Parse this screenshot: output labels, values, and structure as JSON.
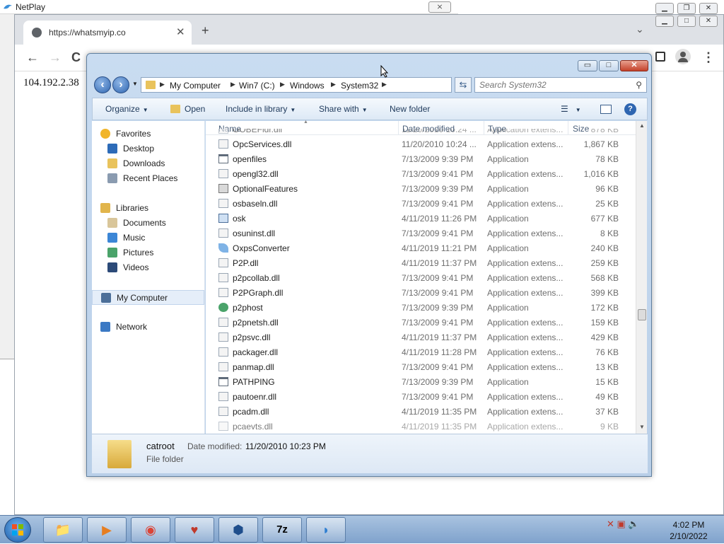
{
  "netplay": {
    "title": "NetPlay",
    "close_label": "⨯"
  },
  "browser": {
    "tab_title": "https://whatsmyip.co",
    "tab_close": "✕",
    "new_tab": "+",
    "tab_dropdown": "⌄",
    "page_text": "104.192.2.38",
    "back": "←",
    "forward": "→",
    "reload": "C",
    "menu": "⋮"
  },
  "explorer": {
    "title_controls": {
      "minimize": "▭",
      "maximize": "□",
      "close": "✕"
    },
    "breadcrumb": [
      "My Computer",
      "Win7 (C:)",
      "Windows",
      "System32"
    ],
    "search_placeholder": "Search System32",
    "commands": [
      {
        "label": "Organize",
        "dropdown": true
      },
      {
        "label": "Open",
        "dropdown": false
      },
      {
        "label": "Include in library",
        "dropdown": true
      },
      {
        "label": "Share with",
        "dropdown": true
      },
      {
        "label": "New folder",
        "dropdown": false
      }
    ],
    "nav": [
      {
        "label": "Favorites",
        "icon": "star-icon",
        "indent": false,
        "top": 0
      },
      {
        "label": "Desktop",
        "icon": "desktop-icon",
        "indent": true
      },
      {
        "label": "Downloads",
        "icon": "folder-icon",
        "indent": true
      },
      {
        "label": "Recent Places",
        "icon": "recent-icon",
        "indent": true
      },
      {
        "label": "Libraries",
        "icon": "library-icon",
        "indent": false
      },
      {
        "label": "Documents",
        "icon": "documents-icon",
        "indent": true
      },
      {
        "label": "Music",
        "icon": "music-icon",
        "indent": true
      },
      {
        "label": "Pictures",
        "icon": "pictures-icon",
        "indent": true
      },
      {
        "label": "Videos",
        "icon": "videos-icon",
        "indent": true
      },
      {
        "label": "My Computer",
        "icon": "computer-icon",
        "indent": false,
        "selected": true
      },
      {
        "label": "Network",
        "icon": "network-icon",
        "indent": false
      }
    ],
    "columns": {
      "name": "Name",
      "date": "Date modified",
      "type": "Type",
      "size": "Size"
    },
    "files": [
      {
        "name": "OOBEFldr.dll",
        "date": "11/20/2010 10:24 ...",
        "type": "Application extens...",
        "size": "878 KB",
        "icon": "dll",
        "partial": true
      },
      {
        "name": "OpcServices.dll",
        "date": "11/20/2010 10:24 ...",
        "type": "Application extens...",
        "size": "1,867 KB",
        "icon": "dll"
      },
      {
        "name": "openfiles",
        "date": "7/13/2009 9:39 PM",
        "type": "Application",
        "size": "78 KB",
        "icon": "exe"
      },
      {
        "name": "opengl32.dll",
        "date": "7/13/2009 9:41 PM",
        "type": "Application extens...",
        "size": "1,016 KB",
        "icon": "dll"
      },
      {
        "name": "OptionalFeatures",
        "date": "7/13/2009 9:39 PM",
        "type": "Application",
        "size": "96 KB",
        "icon": "app"
      },
      {
        "name": "osbaseln.dll",
        "date": "7/13/2009 9:41 PM",
        "type": "Application extens...",
        "size": "25 KB",
        "icon": "dll"
      },
      {
        "name": "osk",
        "date": "4/11/2019 11:26 PM",
        "type": "Application",
        "size": "677 KB",
        "icon": "keyboard"
      },
      {
        "name": "osuninst.dll",
        "date": "7/13/2009 9:41 PM",
        "type": "Application extens...",
        "size": "8 KB",
        "icon": "dll"
      },
      {
        "name": "OxpsConverter",
        "date": "4/11/2019 11:21 PM",
        "type": "Application",
        "size": "240 KB",
        "icon": "plane"
      },
      {
        "name": "P2P.dll",
        "date": "4/11/2019 11:37 PM",
        "type": "Application extens...",
        "size": "259 KB",
        "icon": "dll"
      },
      {
        "name": "p2pcollab.dll",
        "date": "7/13/2009 9:41 PM",
        "type": "Application extens...",
        "size": "568 KB",
        "icon": "dll"
      },
      {
        "name": "P2PGraph.dll",
        "date": "7/13/2009 9:41 PM",
        "type": "Application extens...",
        "size": "399 KB",
        "icon": "dll"
      },
      {
        "name": "p2phost",
        "date": "7/13/2009 9:39 PM",
        "type": "Application",
        "size": "172 KB",
        "icon": "person"
      },
      {
        "name": "p2pnetsh.dll",
        "date": "7/13/2009 9:41 PM",
        "type": "Application extens...",
        "size": "159 KB",
        "icon": "dll"
      },
      {
        "name": "p2psvc.dll",
        "date": "4/11/2019 11:37 PM",
        "type": "Application extens...",
        "size": "429 KB",
        "icon": "dll"
      },
      {
        "name": "packager.dll",
        "date": "4/11/2019 11:28 PM",
        "type": "Application extens...",
        "size": "76 KB",
        "icon": "dll"
      },
      {
        "name": "panmap.dll",
        "date": "7/13/2009 9:41 PM",
        "type": "Application extens...",
        "size": "13 KB",
        "icon": "dll"
      },
      {
        "name": "PATHPING",
        "date": "7/13/2009 9:39 PM",
        "type": "Application",
        "size": "15 KB",
        "icon": "exe"
      },
      {
        "name": "pautoenr.dll",
        "date": "7/13/2009 9:41 PM",
        "type": "Application extens...",
        "size": "49 KB",
        "icon": "dll"
      },
      {
        "name": "pcadm.dll",
        "date": "4/11/2019 11:35 PM",
        "type": "Application extens...",
        "size": "37 KB",
        "icon": "dll"
      },
      {
        "name": "pcaevts.dll",
        "date": "4/11/2019 11:35 PM",
        "type": "Application extens...",
        "size": "9 KB",
        "icon": "dll",
        "partial": true
      }
    ],
    "details": {
      "name": "catroot",
      "date_label": "Date modified:",
      "date_value": "11/20/2010 10:23 PM",
      "type": "File folder"
    }
  },
  "taskbar": {
    "apps": [
      "explorer-icon",
      "media-player-icon",
      "chrome-icon",
      "heart-app-icon",
      "virtualbox-icon",
      "7zip-icon",
      "dolphin-icon"
    ],
    "clock_time": "4:02 PM",
    "clock_date": "2/10/2022"
  },
  "colors": {
    "accent": "#2f66b1",
    "folder": "#e9c35c",
    "taskbar": "#8fb0d6"
  }
}
